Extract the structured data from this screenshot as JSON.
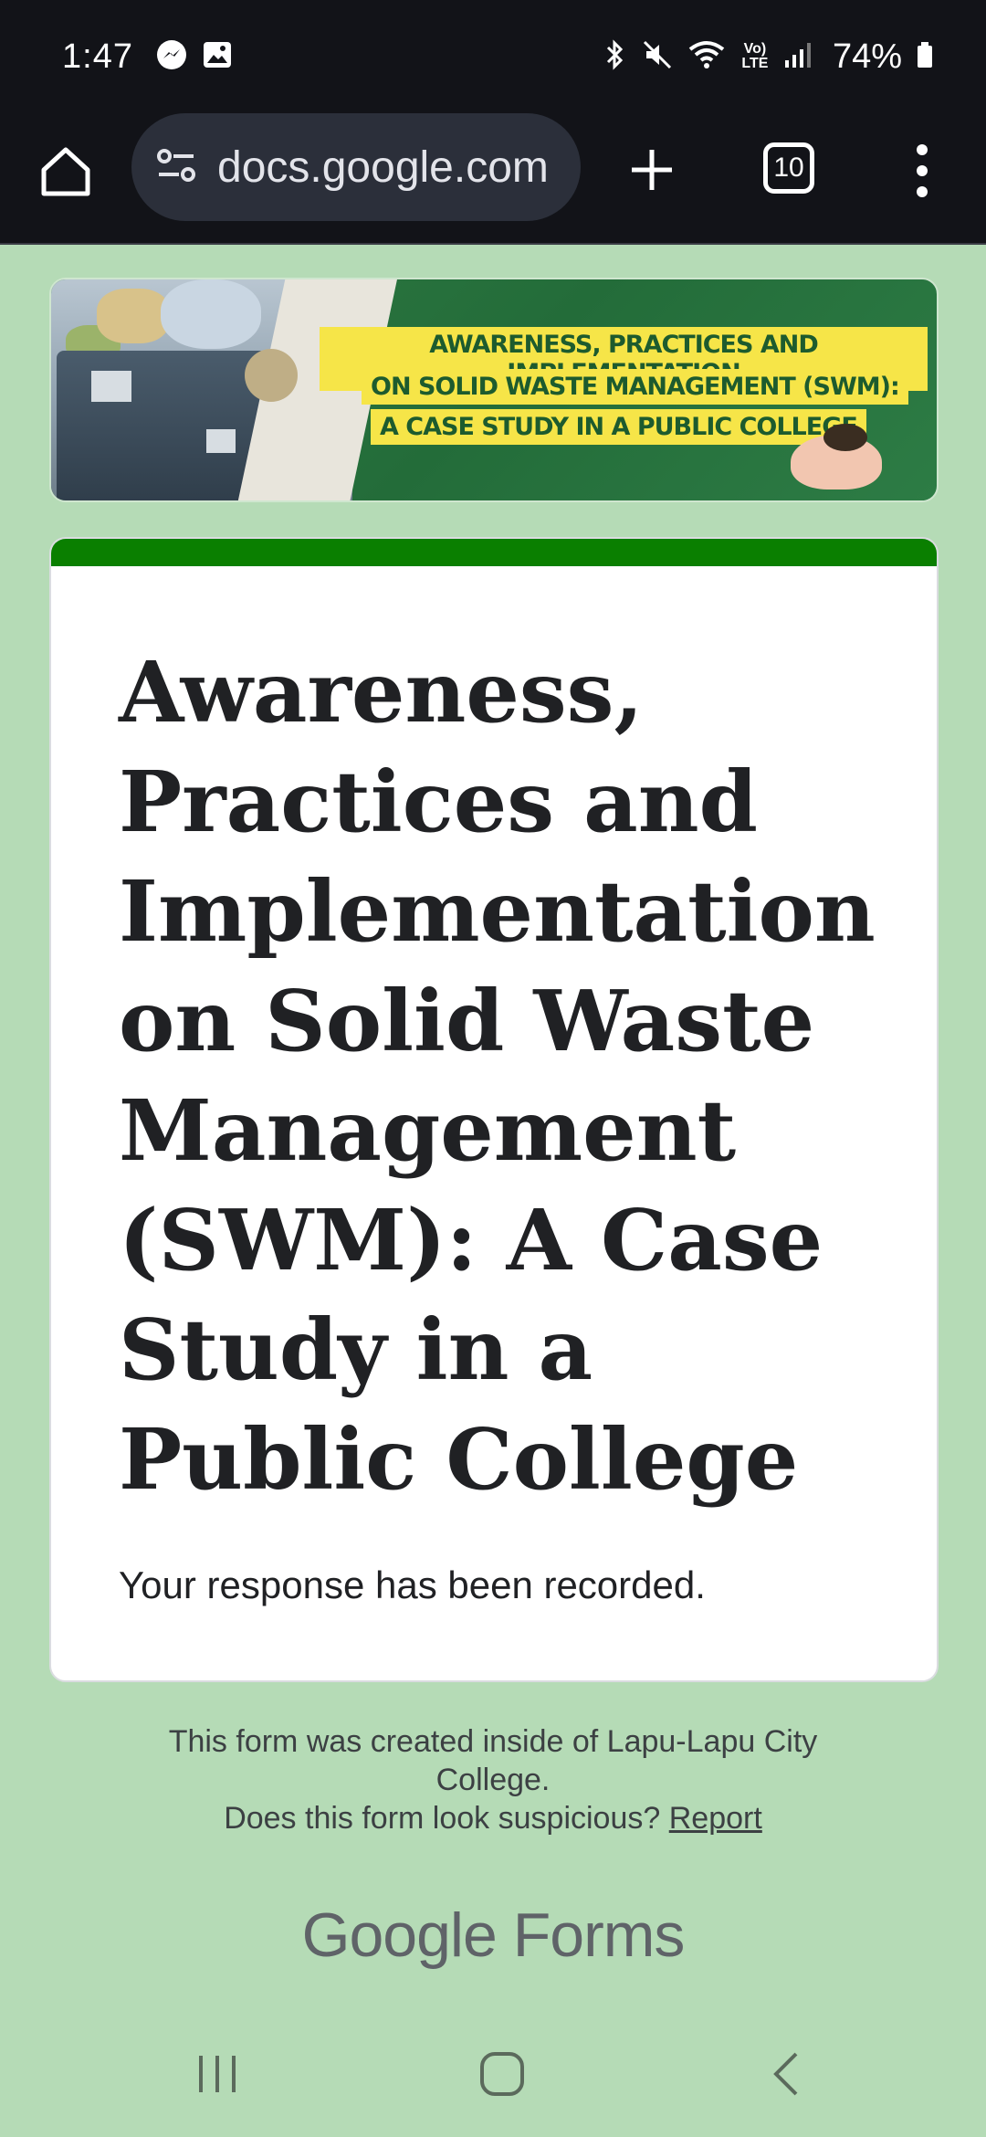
{
  "status_bar": {
    "time": "1:47",
    "battery": "74%",
    "network_label": "Vo) LTE",
    "icons": [
      "messenger-icon",
      "gallery-icon",
      "bluetooth-icon",
      "mute-icon",
      "wifi-icon",
      "volte-icon",
      "signal-icon",
      "battery-icon"
    ]
  },
  "browser": {
    "url": "docs.google.com",
    "tab_count": "10"
  },
  "banner": {
    "line1": "AWARENESS, PRACTICES AND IMPLEMENTATION",
    "line2": "ON SOLID WASTE MANAGEMENT (SWM):",
    "line3": "A CASE STUDY IN A PUBLIC COLLEGE",
    "colors": {
      "background": "#2a7440",
      "highlight": "#f6e548",
      "text": "#1d5b2e"
    }
  },
  "form": {
    "title": "Awareness, Practices and Implementation on Solid Waste Management (SWM): A Case Study in a Public College",
    "confirmation": "Your response has been recorded.",
    "accent_color": "#0a7f00"
  },
  "footer": {
    "created_text_1": "This form was created inside of Lapu-Lapu City",
    "created_text_2": "College.",
    "suspicious_text": "Does this form look suspicious?",
    "report_label": "Report",
    "logo_google": "Google",
    "logo_forms": "Forms"
  },
  "theme": {
    "page_background": "#b5dbb6",
    "bar_background": "#121318"
  }
}
